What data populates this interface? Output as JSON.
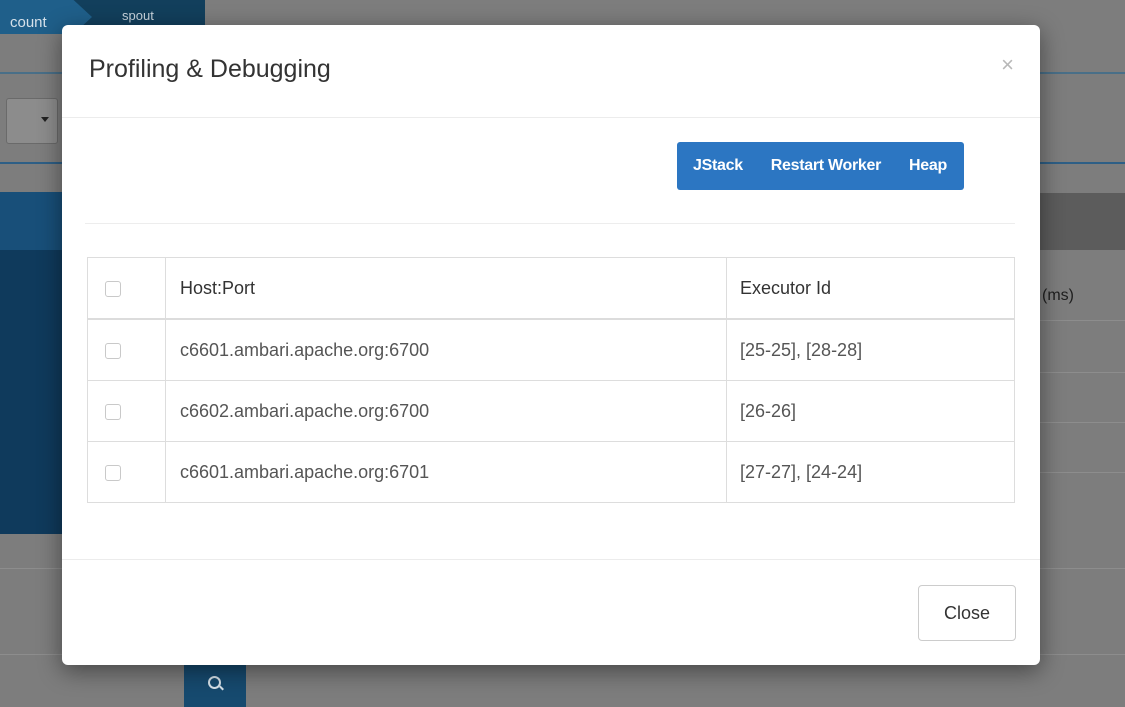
{
  "background": {
    "breadcrumb_1": "count",
    "breadcrumb_2": "spout",
    "partial_header_text": "(ms)"
  },
  "modal": {
    "title": "Profiling & Debugging",
    "close_icon": "×",
    "actions": [
      "JStack",
      "Restart Worker",
      "Heap"
    ],
    "table": {
      "headers": [
        "Host:Port",
        "Executor Id"
      ],
      "rows": [
        {
          "host_port": "c6601.ambari.apache.org:6700",
          "executor_id": "[25-25], [28-28]"
        },
        {
          "host_port": "c6602.ambari.apache.org:6700",
          "executor_id": "[26-26]"
        },
        {
          "host_port": "c6601.ambari.apache.org:6701",
          "executor_id": "[27-27], [24-24]"
        }
      ]
    },
    "footer_close_label": "Close"
  },
  "colors": {
    "primary": "#2c76c2",
    "overlay": "#7d7d7d",
    "nav_dark": "#123f5c"
  }
}
